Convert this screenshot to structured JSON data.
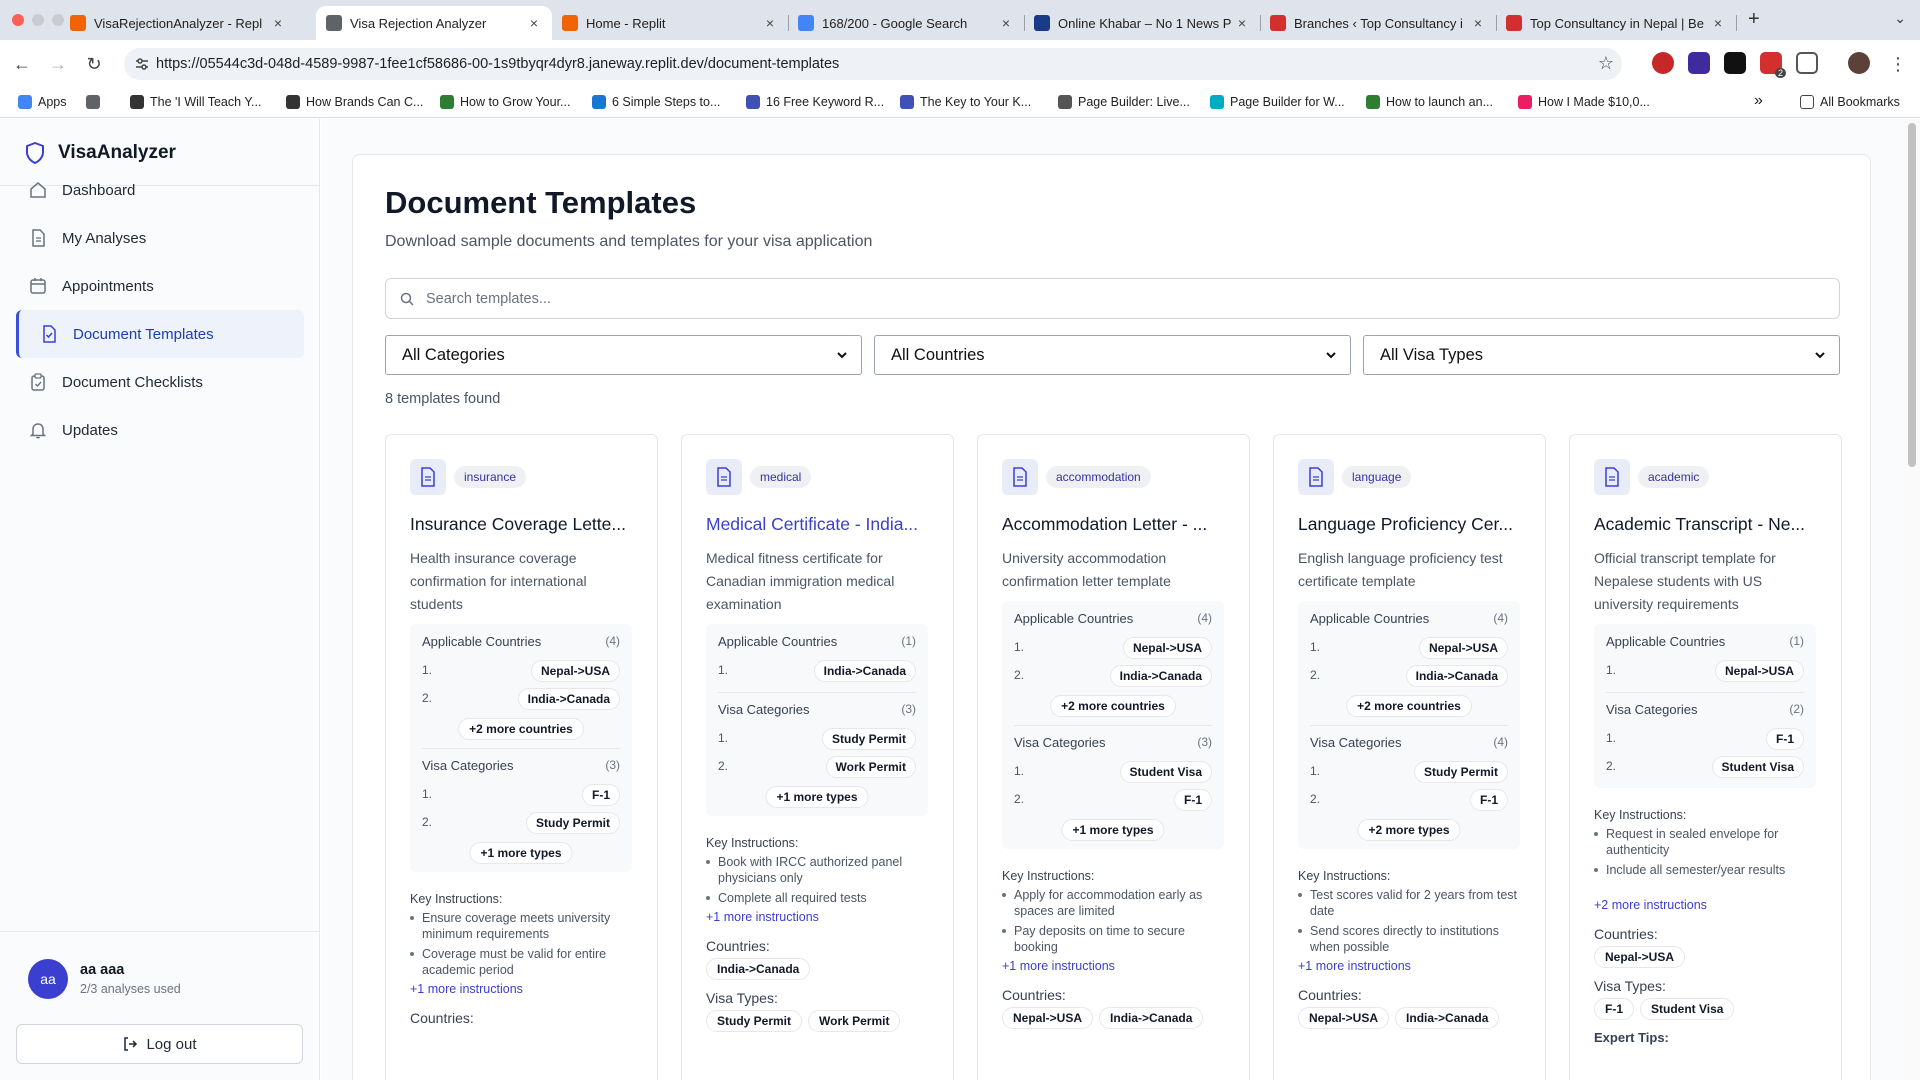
{
  "browser": {
    "tabs": [
      {
        "title": "VisaRejectionAnalyzer - Repl",
        "active": false,
        "color": "#f26207"
      },
      {
        "title": "Visa Rejection Analyzer",
        "active": true,
        "color": "#5f6368"
      },
      {
        "title": "Home - Replit",
        "active": false,
        "color": "#f26207"
      },
      {
        "title": "168/200 - Google Search",
        "active": false,
        "color": "#4285f4"
      },
      {
        "title": "Online Khabar – No 1 News P",
        "active": false,
        "color": "#1a3a8a"
      },
      {
        "title": "Branches ‹ Top Consultancy i",
        "active": false,
        "color": "#d32f2f"
      },
      {
        "title": "Top Consultancy in Nepal | Be",
        "active": false,
        "color": "#d32f2f"
      }
    ],
    "new_tab": "+",
    "url": "https://05544c3d-048d-4589-9987-1fee1cf58686-00-1s9tbyqr4dyr8.janeway.replit.dev/document-templates",
    "extension_badge": "2",
    "bookmarks": [
      {
        "label": "Apps",
        "color": "#4285f4"
      },
      {
        "label": "",
        "color": "#5f6368"
      },
      {
        "label": "The 'I Will Teach Y...",
        "color": "#333333"
      },
      {
        "label": "How Brands Can C...",
        "color": "#333333"
      },
      {
        "label": "How to Grow Your...",
        "color": "#2e7d32"
      },
      {
        "label": "6 Simple Steps to...",
        "color": "#1976d2"
      },
      {
        "label": "16 Free Keyword R...",
        "color": "#3f51b5"
      },
      {
        "label": "The Key to Your K...",
        "color": "#3f51b5"
      },
      {
        "label": "Page Builder: Live...",
        "color": "#555555"
      },
      {
        "label": "Page Builder for W...",
        "color": "#00acc1"
      },
      {
        "label": "How to launch an...",
        "color": "#2e7d32"
      },
      {
        "label": "How I Made $10,0...",
        "color": "#e91e63"
      }
    ],
    "bookmarks_overflow": "»",
    "all_bookmarks": "All Bookmarks"
  },
  "app": {
    "brand": "VisaAnalyzer",
    "nav": [
      {
        "label": "Dashboard",
        "icon": "home-icon",
        "active": false
      },
      {
        "label": "My Analyses",
        "icon": "file-icon",
        "active": false
      },
      {
        "label": "Appointments",
        "icon": "calendar-icon",
        "active": false
      },
      {
        "label": "Document Templates",
        "icon": "file-check-icon",
        "active": true
      },
      {
        "label": "Document Checklists",
        "icon": "clipboard-icon",
        "active": false
      },
      {
        "label": "Updates",
        "icon": "bell-icon",
        "active": false
      }
    ],
    "user": {
      "initials": "aa",
      "name": "aa aaa",
      "usage": "2/3 analyses used"
    },
    "logout_label": "Log out",
    "accent": "#3b3fcf"
  },
  "page": {
    "title": "Document Templates",
    "subtitle": "Download sample documents and templates for your visa application",
    "search_placeholder": "Search templates...",
    "filters": [
      "All Categories",
      "All Countries",
      "All Visa Types"
    ],
    "count_text": "8 templates found"
  },
  "cards": [
    {
      "category": "insurance",
      "title": "Insurance Coverage Lette...",
      "title_link": false,
      "description": "Health insurance coverage confirmation for international students",
      "countries_label": "Applicable Countries",
      "countries_count": "(4)",
      "countries": [
        "Nepal->USA",
        "India->Canada"
      ],
      "countries_more": "+2 more countries",
      "visas_label": "Visa Categories",
      "visas_count": "(3)",
      "visas": [
        "F-1",
        "Study Permit"
      ],
      "visas_more": "+1 more types",
      "key_label": "Key Instructions:",
      "instructions": [
        "Ensure coverage meets university minimum requirements",
        "Coverage must be valid for entire academic period"
      ],
      "instructions_more": "+1 more instructions",
      "countries_footer_label": "Countries:",
      "countries_footer": [],
      "visa_types_label": "",
      "visa_types": [],
      "expert_tips_label": ""
    },
    {
      "category": "medical",
      "title": "Medical Certificate - India...",
      "title_link": true,
      "description": "Medical fitness certificate for Canadian immigration medical examination",
      "countries_label": "Applicable Countries",
      "countries_count": "(1)",
      "countries": [
        "India->Canada"
      ],
      "countries_more": "",
      "visas_label": "Visa Categories",
      "visas_count": "(3)",
      "visas": [
        "Study Permit",
        "Work Permit"
      ],
      "visas_more": "+1 more types",
      "key_label": "Key Instructions:",
      "instructions": [
        "Book with IRCC authorized panel physicians only",
        "Complete all required tests"
      ],
      "instructions_more": "+1 more instructions",
      "countries_footer_label": "Countries:",
      "countries_footer": [
        "India->Canada"
      ],
      "visa_types_label": "Visa Types:",
      "visa_types": [
        "Study Permit",
        "Work Permit"
      ],
      "expert_tips_label": ""
    },
    {
      "category": "accommodation",
      "title": "Accommodation Letter - ...",
      "title_link": false,
      "description": "University accommodation confirmation letter template",
      "countries_label": "Applicable Countries",
      "countries_count": "(4)",
      "countries": [
        "Nepal->USA",
        "India->Canada"
      ],
      "countries_more": "+2 more countries",
      "visas_label": "Visa Categories",
      "visas_count": "(3)",
      "visas": [
        "Student Visa",
        "F-1"
      ],
      "visas_more": "+1 more types",
      "key_label": "Key Instructions:",
      "instructions": [
        "Apply for accommodation early as spaces are limited",
        "Pay deposits on time to secure booking"
      ],
      "instructions_more": "+1 more instructions",
      "countries_footer_label": "Countries:",
      "countries_footer": [
        "Nepal->USA",
        "India->Canada"
      ],
      "visa_types_label": "",
      "visa_types": [],
      "expert_tips_label": ""
    },
    {
      "category": "language",
      "title": "Language Proficiency Cer...",
      "title_link": false,
      "description": "English language proficiency test certificate template",
      "countries_label": "Applicable Countries",
      "countries_count": "(4)",
      "countries": [
        "Nepal->USA",
        "India->Canada"
      ],
      "countries_more": "+2 more countries",
      "visas_label": "Visa Categories",
      "visas_count": "(4)",
      "visas": [
        "Study Permit",
        "F-1"
      ],
      "visas_more": "+2 more types",
      "key_label": "Key Instructions:",
      "instructions": [
        "Test scores valid for 2 years from test date",
        "Send scores directly to institutions when possible"
      ],
      "instructions_more": "+1 more instructions",
      "countries_footer_label": "Countries:",
      "countries_footer": [
        "Nepal->USA",
        "India->Canada"
      ],
      "visa_types_label": "",
      "visa_types": [],
      "expert_tips_label": ""
    },
    {
      "category": "academic",
      "title": "Academic Transcript - Ne...",
      "title_link": false,
      "description": "Official transcript template for Nepalese students with US university requirements",
      "countries_label": "Applicable Countries",
      "countries_count": "(1)",
      "countries": [
        "Nepal->USA"
      ],
      "countries_more": "",
      "visas_label": "Visa Categories",
      "visas_count": "(2)",
      "visas": [
        "F-1",
        "Student Visa"
      ],
      "visas_more": "",
      "key_label": "Key Instructions:",
      "instructions": [
        "Request in sealed envelope for authenticity",
        "Include all semester/year results"
      ],
      "instructions_more": "+2 more instructions",
      "countries_footer_label": "Countries:",
      "countries_footer": [
        "Nepal->USA"
      ],
      "visa_types_label": "Visa Types:",
      "visa_types": [
        "F-1",
        "Student Visa"
      ],
      "expert_tips_label": "Expert Tips:"
    }
  ]
}
